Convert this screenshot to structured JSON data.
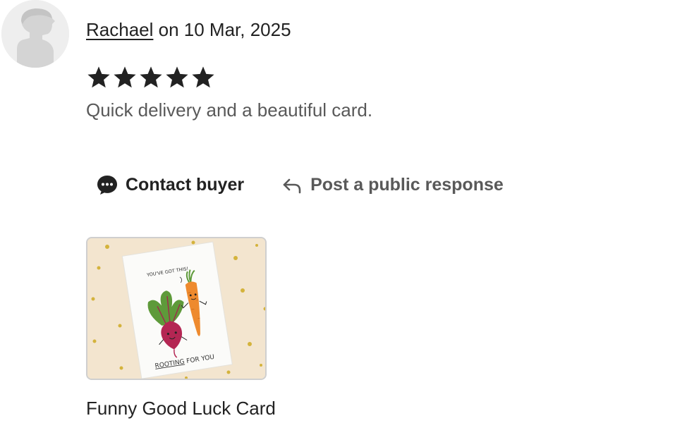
{
  "review": {
    "author": "Rachael",
    "date_text": " on 10 Mar, 2025",
    "rating": 5,
    "rating_max": 5,
    "text": "Quick delivery and a beautiful card."
  },
  "actions": {
    "contact_label": "Contact buyer",
    "respond_label": "Post a public response"
  },
  "listing": {
    "title": "Funny Good Luck Card",
    "card_text_top": "YOU'VE GOT THIS!",
    "card_text_bottom_underlined": "ROOTING",
    "card_text_bottom_rest": " FOR YOU"
  },
  "colors": {
    "star": "#222222",
    "text_primary": "#222222",
    "text_secondary": "#595959",
    "image_background": "#f3e5cf",
    "confetti_gold": "#d4b33c"
  },
  "icons": {
    "contact": "chat-bubble-dots-icon",
    "respond": "reply-arrow-icon",
    "avatar": "default-avatar-icon"
  }
}
